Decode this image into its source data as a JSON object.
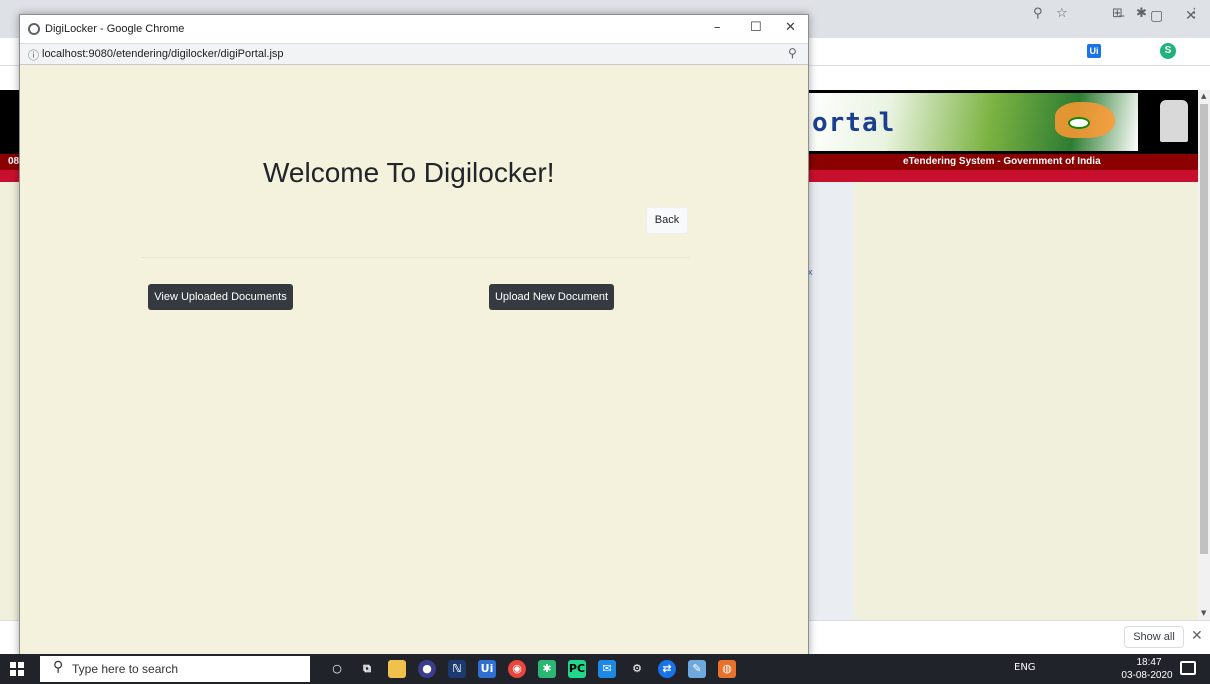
{
  "popup": {
    "window_title": "DigiLocker - Google Chrome",
    "url": "localhost:9080/etendering/digilocker/digiPortal.jsp",
    "heading": "Welcome To Digilocker!",
    "back_label": "Back",
    "view_docs_label": "View Uploaded Documents",
    "upload_doc_label": "Upload New Document"
  },
  "background_page": {
    "banner_text": "ortal",
    "red_bar_text": "eTendering System - Government of India",
    "left_red_text": "08",
    "side_mark": "x"
  },
  "download_bar": {
    "show_all_label": "Show all"
  },
  "taskbar": {
    "search_placeholder": "Type here to search",
    "tray_text": "ENG",
    "time": "18:47",
    "date": "03-08-2020"
  },
  "colors": {
    "page_background": "#f4f2dc",
    "dark_button": "#343a40",
    "red_bar": "#8b0000",
    "taskbar": "#20232a"
  }
}
